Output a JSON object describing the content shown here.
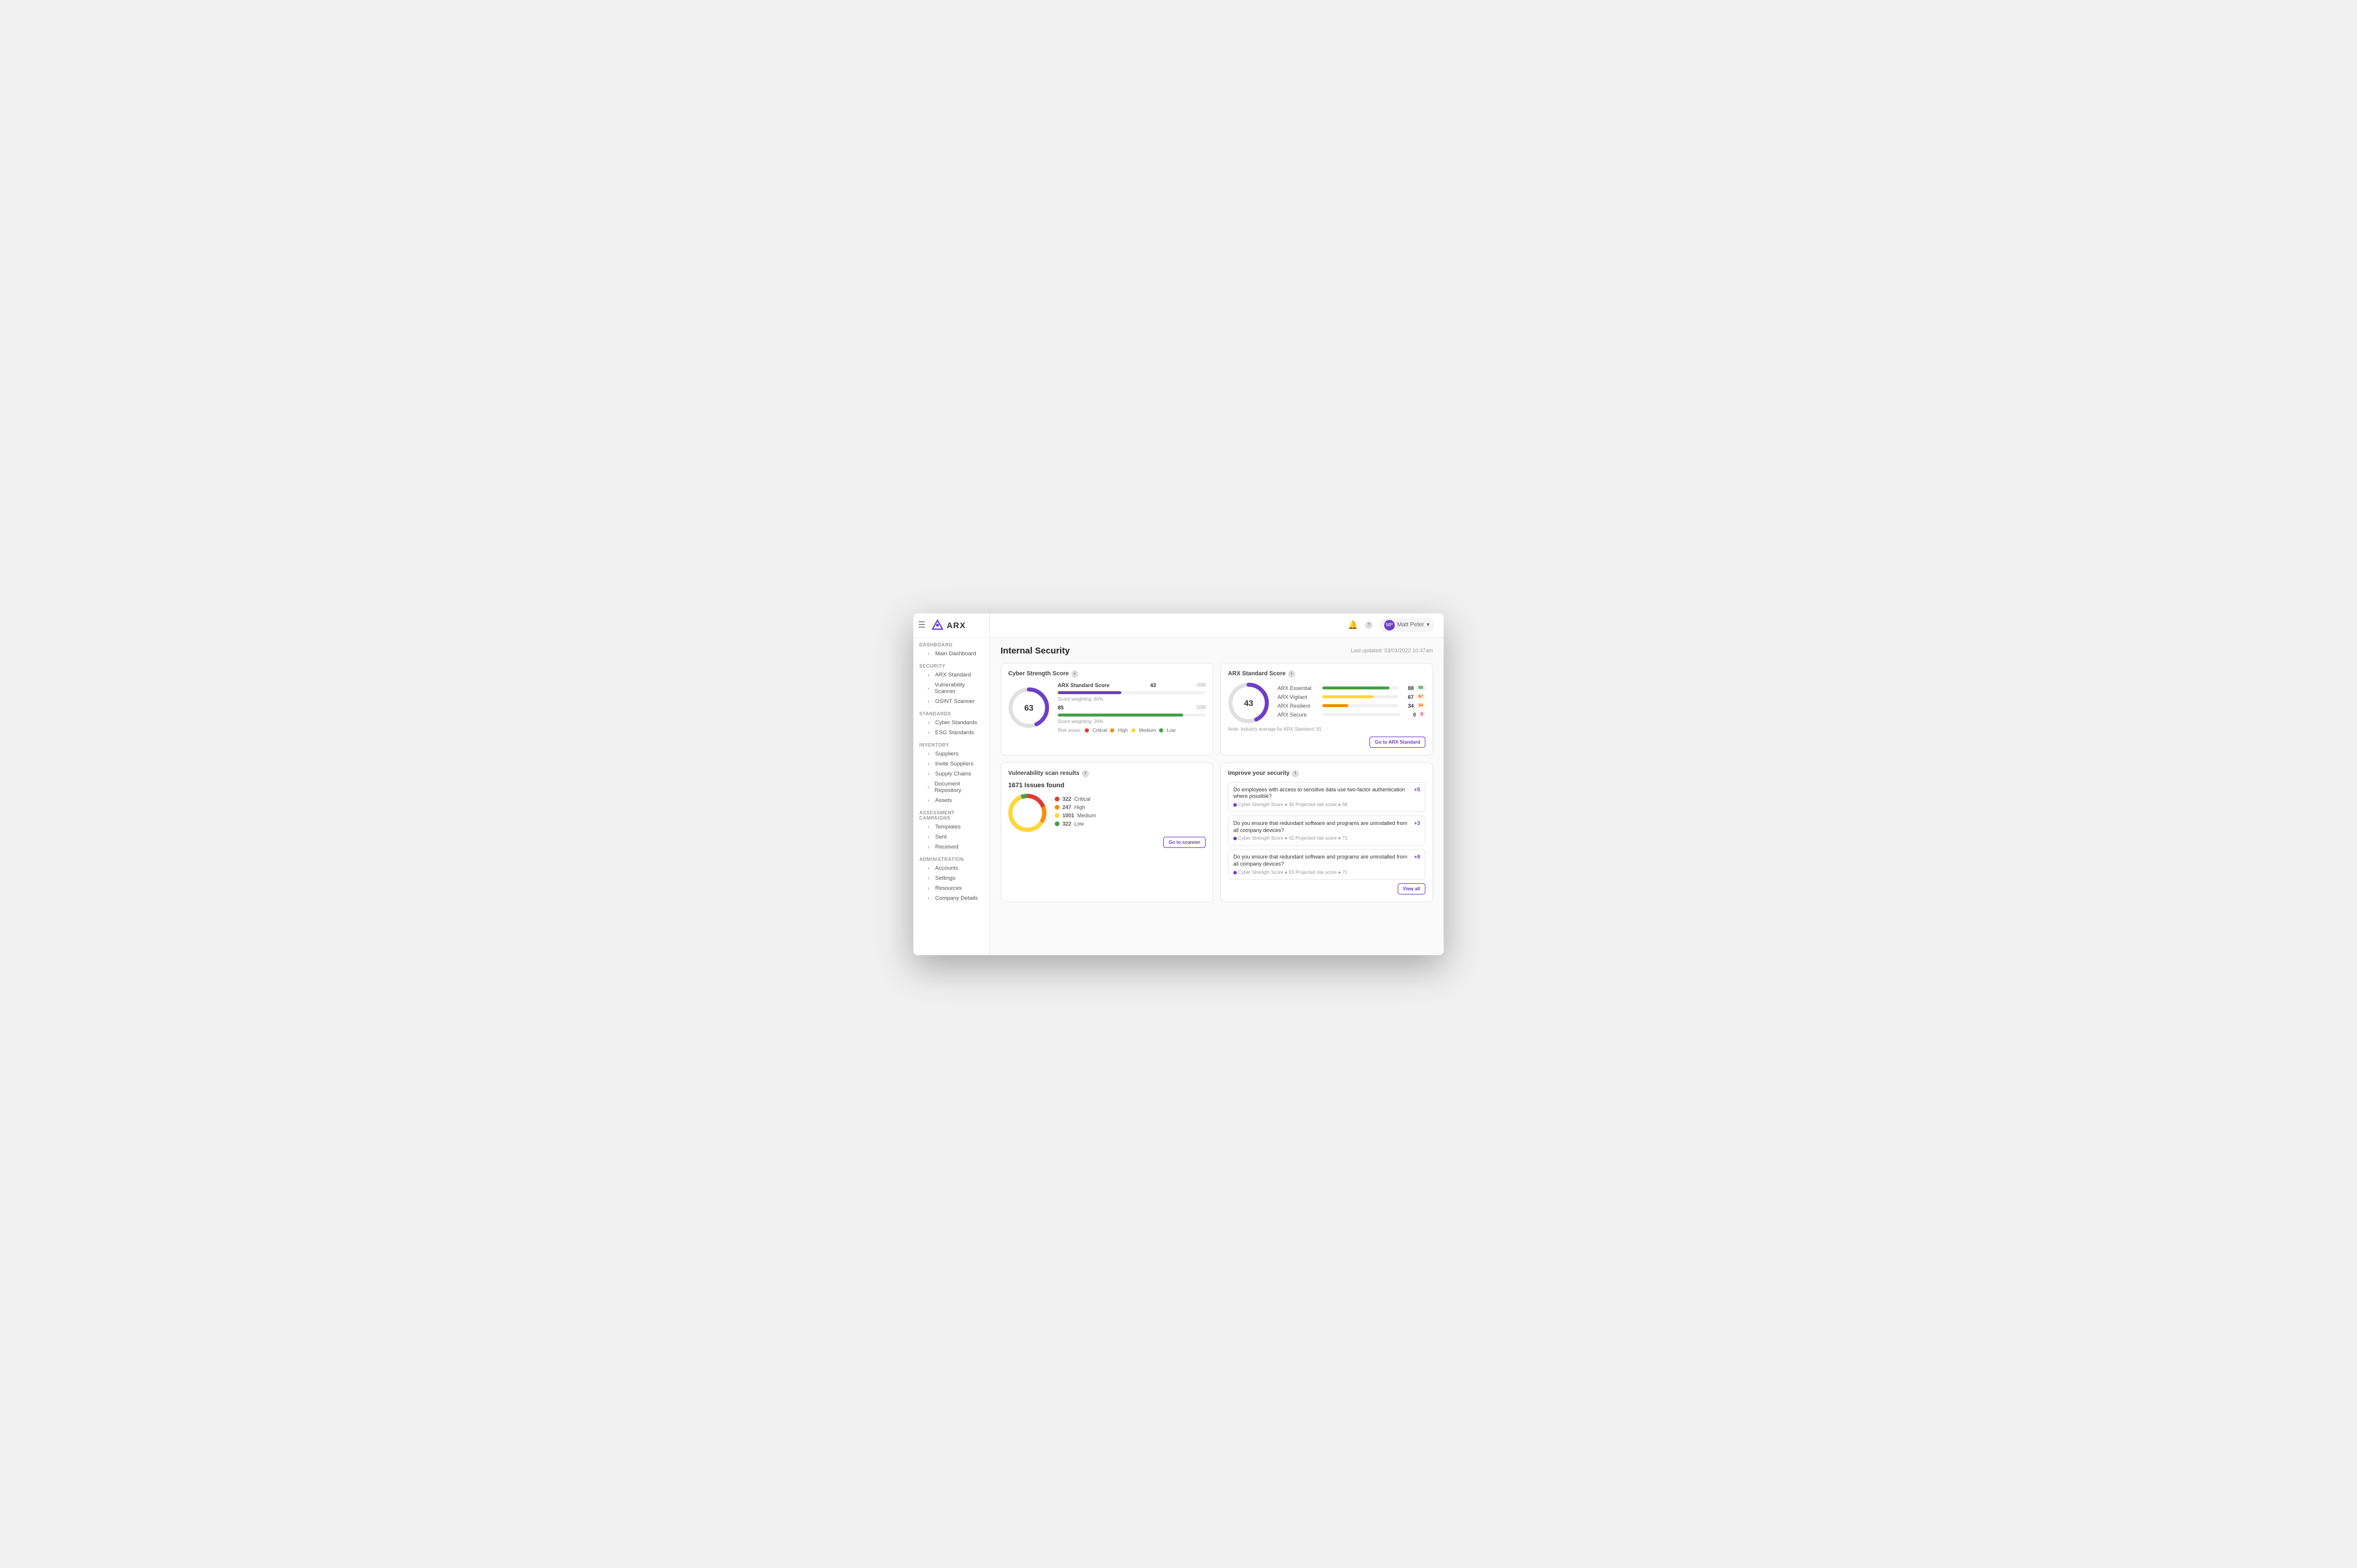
{
  "app": {
    "logo_text": "ARX",
    "hamburger": "☰"
  },
  "topnav": {
    "bell_icon": "🔔",
    "help_icon": "?",
    "user_icon": "👤",
    "user_name": "Matt Peter",
    "chevron": "▾"
  },
  "sidebar": {
    "sections": [
      {
        "label": "DASHBOARD",
        "icon": "⊞",
        "items": [
          {
            "name": "main-dashboard",
            "label": "Main Dashboard",
            "active": false
          }
        ]
      },
      {
        "label": "SECURITY",
        "icon": "🛡",
        "items": [
          {
            "name": "arx-standard",
            "label": "ARX Standard",
            "active": false
          },
          {
            "name": "vulnerability-scanner",
            "label": "Vulnerability Scanner",
            "active": false
          },
          {
            "name": "osint-scanner",
            "label": "OSINT Scanner",
            "active": false
          }
        ]
      },
      {
        "label": "STANDARDS",
        "icon": "☰",
        "items": [
          {
            "name": "cyber-standards",
            "label": "Cyber Standards",
            "active": false
          },
          {
            "name": "esg-standards",
            "label": "ESG Standards",
            "active": false
          }
        ]
      },
      {
        "label": "INVENTORY",
        "icon": "👤",
        "items": [
          {
            "name": "suppliers",
            "label": "Suppliers",
            "active": false
          },
          {
            "name": "invite-suppliers",
            "label": "Invite Suppliers",
            "active": false
          },
          {
            "name": "supply-chains",
            "label": "Supply Chains",
            "active": false
          },
          {
            "name": "document-repository",
            "label": "Document Repository",
            "active": false
          },
          {
            "name": "assets",
            "label": "Assets",
            "active": false
          }
        ]
      },
      {
        "label": "ASSESSMENT CAMPAIGNS",
        "icon": "📋",
        "items": [
          {
            "name": "templates",
            "label": "Templates",
            "active": false
          },
          {
            "name": "sent",
            "label": "Sent",
            "active": false
          },
          {
            "name": "received",
            "label": "Received",
            "active": false
          }
        ]
      },
      {
        "label": "ADMINISTRATION",
        "icon": "⚙",
        "items": [
          {
            "name": "accounts",
            "label": "Accounts",
            "active": false
          },
          {
            "name": "settings",
            "label": "Settings",
            "active": false
          },
          {
            "name": "resources",
            "label": "Resources",
            "active": false
          },
          {
            "name": "company-details",
            "label": "Company Details",
            "active": false
          }
        ]
      }
    ]
  },
  "page": {
    "title": "Internal Security",
    "last_updated": "Last updated: 03/01/2022 10:47am"
  },
  "cyber_strength": {
    "title": "Cyber Strength Score",
    "score": "63",
    "max": "100",
    "arx_label": "ARX Standard Score",
    "arx_score": "43",
    "arx_max": "100",
    "arx_weighting": "Score weighting: 60%",
    "arx_bar_pct": 43,
    "secondary_score": "85",
    "secondary_max": "100",
    "secondary_weighting": "Score weighting: 20%",
    "secondary_bar_pct": 85,
    "risk_label": "Risk areas:",
    "risk_items": [
      {
        "label": "Critical",
        "color": "#e53935"
      },
      {
        "label": "High",
        "color": "#fb8c00"
      },
      {
        "label": "Medium",
        "color": "#fdd835"
      },
      {
        "label": "Low",
        "color": "#43a047"
      }
    ],
    "donut_segments": [
      {
        "color": "#6c3fc5",
        "pct": 43
      },
      {
        "color": "#e0e0e0",
        "pct": 57
      }
    ]
  },
  "arx_standard": {
    "title": "ARX Standard Score",
    "score": "43",
    "rows": [
      {
        "name": "ARX Essential",
        "value": 88,
        "max": 100,
        "color": "#43a047",
        "badge": "88",
        "badge_type": "green"
      },
      {
        "name": "ARX Vigilant",
        "value": 67,
        "max": 100,
        "color": "#fdd835",
        "badge": "67",
        "badge_type": "orange"
      },
      {
        "name": "ARX Resilient",
        "value": 34,
        "max": 100,
        "color": "#fb8c00",
        "badge": "34",
        "badge_type": "orange"
      },
      {
        "name": "ARX Secure",
        "value": 0,
        "max": 100,
        "color": "#e53935",
        "badge": "0",
        "badge_type": "red"
      }
    ],
    "note": "Note: Industry average for ARX Standard: 81",
    "btn_label": "Go to ARX Standard",
    "donut_segments": [
      {
        "color": "#6c3fc5",
        "pct": 43
      },
      {
        "color": "#e0e0e0",
        "pct": 57
      }
    ]
  },
  "vuln_scan": {
    "title": "Vulnerability scan results",
    "total_label": "1671 Issues found",
    "items": [
      {
        "label": "Critical",
        "count": "322",
        "color": "#e53935"
      },
      {
        "label": "High",
        "count": "247",
        "color": "#fb8c00"
      },
      {
        "label": "Medium",
        "count": "1001",
        "color": "#fdd835"
      },
      {
        "label": "Low",
        "count": "322",
        "color": "#43a047"
      }
    ],
    "btn_label": "Go to scanner"
  },
  "improve": {
    "title": "Improve your security",
    "items": [
      {
        "text": "Do employees with access to sensitive data use two-factor authentication where possible?",
        "plus": "+5",
        "meta": "Cyber Strength Score  ● 40  Projected risk score ● 68"
      },
      {
        "text": "Do you ensure that redundant software and programs are uninstalled from all company devices?",
        "plus": "+3",
        "meta": "Cyber Strength Score  ● 42  Projected risk score ● 71"
      },
      {
        "text": "Do you ensure that redundant software and programs are uninstalled from all company devices?",
        "plus": "+8",
        "meta": "Cyber Strength Score  ● 63  Projected risk score ● 71"
      }
    ],
    "view_all_label": "View all"
  }
}
